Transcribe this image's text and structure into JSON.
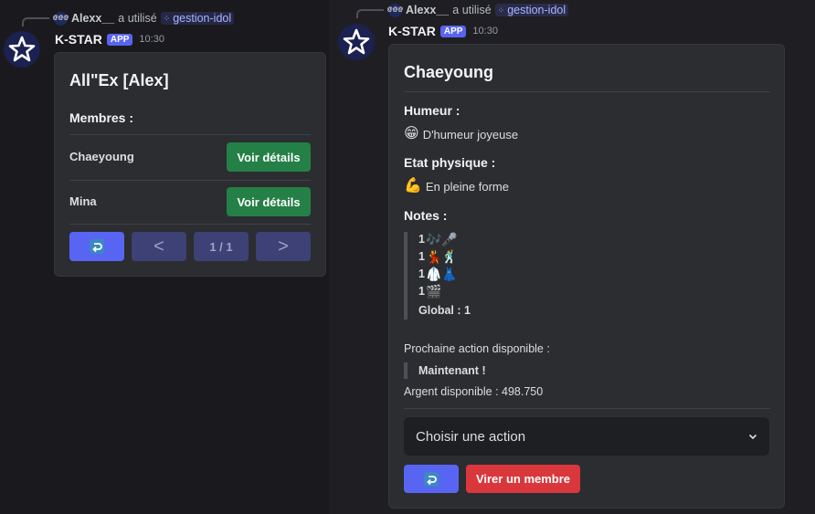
{
  "left": {
    "reply": {
      "avatar_text": "@@@",
      "user": "Alexx__",
      "action": "a utilisé",
      "command": "gestion-idol"
    },
    "header": {
      "bot_name": "K-STAR",
      "tag": "APP",
      "time": "10:30"
    },
    "embed": {
      "title": "All\"Ex [Alex]",
      "members_title": "Membres :",
      "members": [
        {
          "name": "Chaeyoung",
          "button": "Voir détails"
        },
        {
          "name": "Mina",
          "button": "Voir détails"
        }
      ],
      "pagination": {
        "page": "1 / 1",
        "prev": "<",
        "next": ">",
        "back_icon": "return-arrow-icon"
      }
    }
  },
  "right": {
    "reply": {
      "avatar_text": "@@@",
      "user": "Alexx__",
      "action": "a utilisé",
      "command": "gestion-idol"
    },
    "header": {
      "bot_name": "K-STAR",
      "tag": "APP",
      "time": "10:30"
    },
    "embed": {
      "title": "Chaeyoung",
      "mood_title": "Humeur :",
      "mood_emoji": "😁",
      "mood_text": "D'humeur joyeuse",
      "physical_title": "Etat physique :",
      "physical_emoji": "💪",
      "physical_text": "En pleine forme",
      "notes_title": "Notes :",
      "notes": [
        {
          "value": "1",
          "emoji": "🎶🎤"
        },
        {
          "value": "1",
          "emoji": "💃🕺"
        },
        {
          "value": "1",
          "emoji": "🥼👗"
        },
        {
          "value": "1",
          "emoji": "🎬"
        }
      ],
      "global": "Global : 1",
      "next_action_label": "Prochaine action disponible :",
      "next_action_value": "Maintenant !",
      "money": "Argent disponible : 498.750",
      "select_placeholder": "Choisir une action",
      "fire_button": "Virer un membre"
    }
  },
  "colors": {
    "blurple": "#5865f2",
    "green": "#248046",
    "red": "#da373c",
    "embed_bg": "#2b2d31"
  }
}
